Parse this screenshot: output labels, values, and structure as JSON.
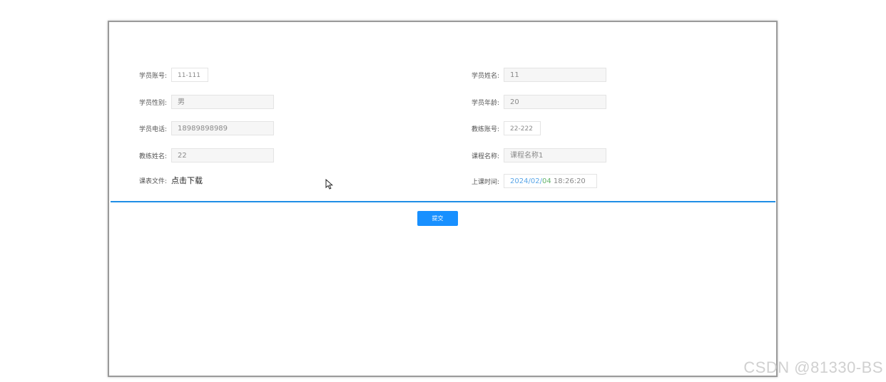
{
  "form": {
    "student_account": {
      "label": "学员账号:",
      "value": "11-111"
    },
    "student_name": {
      "label": "学员姓名:",
      "value": "11"
    },
    "student_gender": {
      "label": "学员性别:",
      "value": "男"
    },
    "student_age": {
      "label": "学员年龄:",
      "value": "20"
    },
    "student_phone": {
      "label": "学员电话:",
      "value": "18989898989"
    },
    "coach_account": {
      "label": "教练账号:",
      "value": "22-222"
    },
    "coach_name": {
      "label": "教练姓名:",
      "value": "22"
    },
    "course_name": {
      "label": "课程名称:",
      "value": "课程名称1"
    },
    "schedule_file": {
      "label": "课表文件:",
      "link": "点击下载"
    },
    "class_time": {
      "label": "上课时间:",
      "date_part1": "2024/02/",
      "date_part2": "04",
      "time_part": " 18:26:20"
    }
  },
  "actions": {
    "submit_label": "提交"
  },
  "watermark": "CSDN @81330-BS",
  "colors": {
    "accent": "#1890ff",
    "divider": "#1f8ee6",
    "date_blue": "#5aa6e8",
    "date_green": "#63b36a"
  }
}
